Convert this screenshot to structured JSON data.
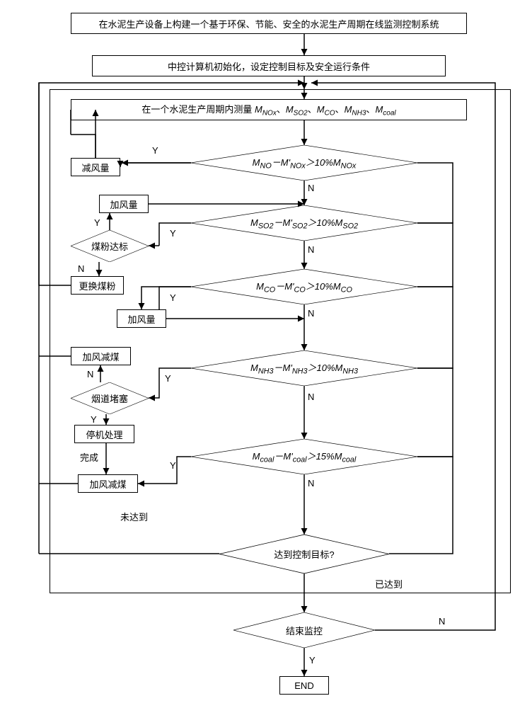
{
  "boxes": {
    "b1": "在水泥生产设备上构建一个基于环保、节能、安全的水泥生产周期在线监测控制系统",
    "b2": "中控计算机初始化，设定控制目标及安全运行条件",
    "b3_prefix": "在一个水泥生产周期内测量 ",
    "b3_vars": [
      "M_NOx",
      "M_SO2",
      "M_CO",
      "M_NH3",
      "M_coal"
    ],
    "reduce_air": "减风量",
    "add_air": "加风量",
    "change_coal": "更换煤粉",
    "add_air_reduce_coal": "加风减煤",
    "stop_process": "停机处理",
    "end": "END"
  },
  "diamonds": {
    "d_nox": "M_NO − M'_NOx > 10% M_NOx",
    "d_so2": "M_SO2 − M'_SO2 > 10% M_SO2",
    "d_co": "M_CO − M'_CO > 10% M_CO",
    "d_nh3": "M_NH3 − M'_NH3 > 10% M_NH3",
    "d_coal": "M_coal − M'_coal > 15% M_coal",
    "d_coalstd": "煤粉达标",
    "d_flue": "烟道堵塞",
    "d_target": "达到控制目标?",
    "d_endmon": "结束监控"
  },
  "labels": {
    "Y": "Y",
    "N": "N",
    "done": "完成",
    "not_reached": "未达到",
    "reached": "已达到"
  }
}
